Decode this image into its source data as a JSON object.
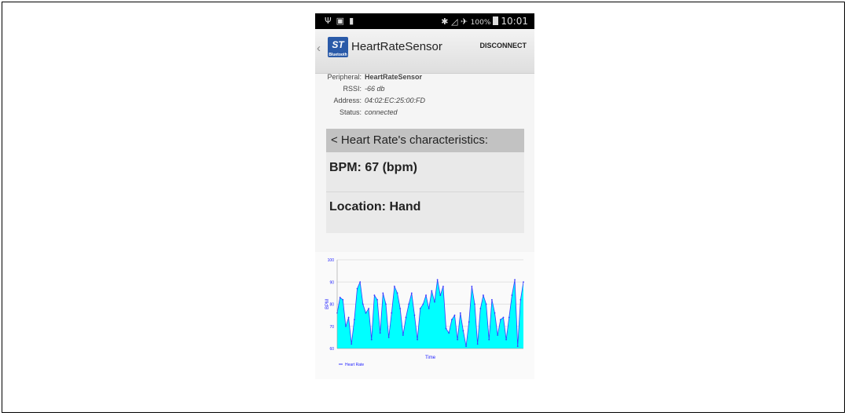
{
  "status_bar": {
    "left_icons": [
      "usb-icon",
      "image-icon",
      "sdcard-icon"
    ],
    "right_icons": [
      "bluetooth-icon",
      "no-signal-icon",
      "airplane-icon"
    ],
    "battery_pct": "100%",
    "time": "10:01"
  },
  "action_bar": {
    "title": "HeartRateSensor",
    "logo_text": "ST",
    "logo_sub": "Bluetooth",
    "disconnect_label": "DISCONNECT"
  },
  "device_info": {
    "peripheral_label": "Peripheral:",
    "peripheral": "HeartRateSensor",
    "rssi_label": "RSSI:",
    "rssi": "-66 db",
    "address_label": "Address:",
    "address": "04:02:EC:25:00:FD",
    "status_label": "Status:",
    "status": "connected"
  },
  "characteristics": {
    "header": "< Heart Rate's characteristics:",
    "bpm": "BPM: 67 (bpm)",
    "location": "Location: Hand"
  },
  "colors": {
    "fill": "#00ffff",
    "line": "#3a3aff",
    "axis_text": "#2323ff"
  },
  "chart_data": {
    "type": "area",
    "ylabel": "BPM",
    "xlabel": "Time",
    "ylim": [
      60,
      100
    ],
    "yticks": [
      60,
      70,
      80,
      90,
      100
    ],
    "legend": "Heart Rate",
    "legend_position": "bottom-left",
    "grid": true,
    "series": [
      {
        "name": "Heart Rate",
        "values": [
          76,
          83,
          82,
          70,
          74,
          62,
          73,
          87,
          90,
          80,
          76,
          78,
          64,
          84,
          82,
          67,
          85,
          80,
          65,
          76,
          88,
          85,
          78,
          66,
          74,
          80,
          85,
          75,
          64,
          78,
          80,
          84,
          78,
          86,
          81,
          91,
          84,
          88,
          69,
          67,
          73,
          75,
          64,
          76,
          68,
          61,
          72,
          88,
          80,
          62,
          78,
          84,
          80,
          64,
          82,
          76,
          66,
          73,
          74,
          64,
          74,
          84,
          91,
          61,
          82,
          90
        ]
      }
    ]
  }
}
